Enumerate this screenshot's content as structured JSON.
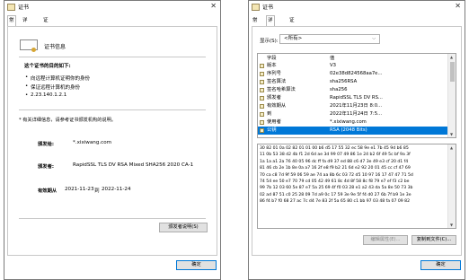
{
  "window1": {
    "title": "证书",
    "close_glyph": "✕",
    "tabs": [
      "常规",
      "详细信息",
      "证书路径"
    ],
    "cert_info_title": "证书信息",
    "purpose_heading": "这个证书的目的如下:",
    "purposes": [
      "向远程计算机证明你的身份",
      "保证远程计算机的身份",
      "2.23.140.1.2.1"
    ],
    "note": "* 有关详细信息，请参考证书颁发机构的说明。",
    "issued_to_label": "颁发给:",
    "issued_to_value": "*.xixiwang.com",
    "issued_by_label": "颁发者:",
    "issued_by_value": "RapidSSL TLS DV RSA Mixed SHA256 2020 CA-1",
    "validity_label": "有效期从",
    "validity_from": "2021-11-23",
    "validity_to_word": "到",
    "validity_to": "2022-11-24",
    "issuer_statement_button": "颁发者说明(S)",
    "ok_button": "确定"
  },
  "window2": {
    "title": "证书",
    "close_glyph": "✕",
    "tabs": [
      "常规",
      "详细信息",
      "证书路径"
    ],
    "show_label": "显示(S):",
    "show_value": "<所有>",
    "columns": [
      "字段",
      "值"
    ],
    "rows": [
      {
        "field": "版本",
        "value": "V3"
      },
      {
        "field": "序列号",
        "value": "02e38d824568aa7e..."
      },
      {
        "field": "签名算法",
        "value": "sha256RSA"
      },
      {
        "field": "签名哈希算法",
        "value": "sha256"
      },
      {
        "field": "颁发者",
        "value": "RapidSSL TLS DV RS..."
      },
      {
        "field": "有效期从",
        "value": "2021年11月23日 8:0..."
      },
      {
        "field": "到",
        "value": "2022年11月24日 7:5..."
      },
      {
        "field": "使用者",
        "value": "*.xixiwang.com"
      },
      {
        "field": "公钥",
        "value": "RSA (2048 Bits)"
      }
    ],
    "selected_row": 8,
    "hex_lines": [
      "30 82 01 0a 02 82 01 01 00 b6 d5 17 55 32 ec 58 9e e1 7b 45 9d b6 85",
      "11 0b 53 38 d2 4b f1 2d 6d ae 3d 99 07 49 86 1e 24 b2 6f 49 5c bf 9a 3f",
      "1a 1a a1 2a 76 40 05 96 dc ff fa d9 37 ed 88 c6 d7 3e 49 e3 cf 20 d1 f4",
      "81 46 cb 2e 1b 8e 0a a7 16 2f e8 f9 b2 21 6d e2 92 20 01 45 cc cf 47 69",
      "70 ca c8 7d 9f 59 06 59 ae 74 aa 8b 6c 03 72 d5 10 97 16 17 47 47 71 5d",
      "74 54 ee 50 e7 70 79 cd 05 42 49 61 8c 4d 8f 58 8c f8 79 e7 ef f3 c2 be",
      "99 7b 12 03 60 5e 87 e7 5a 25 69 4f f0 03 28 e1 a2 43 da 5a 8e 50 73 3b",
      "02 ad 87 51 c0 25 28 09 7d a9 0c 17 59 3e 9e 5f f4 d0 27 6b 7f b9 1e 3e",
      "86 f4 b7 f0 68 27 ac 7c d4 7e 83 2f 5a 65 80 c1 bb 97 03 48 fa 07 09 82"
    ],
    "edit_properties_button": "编辑属性(E)...",
    "copy_to_file_button": "复制到文件(C)...",
    "ok_button": "确定"
  }
}
